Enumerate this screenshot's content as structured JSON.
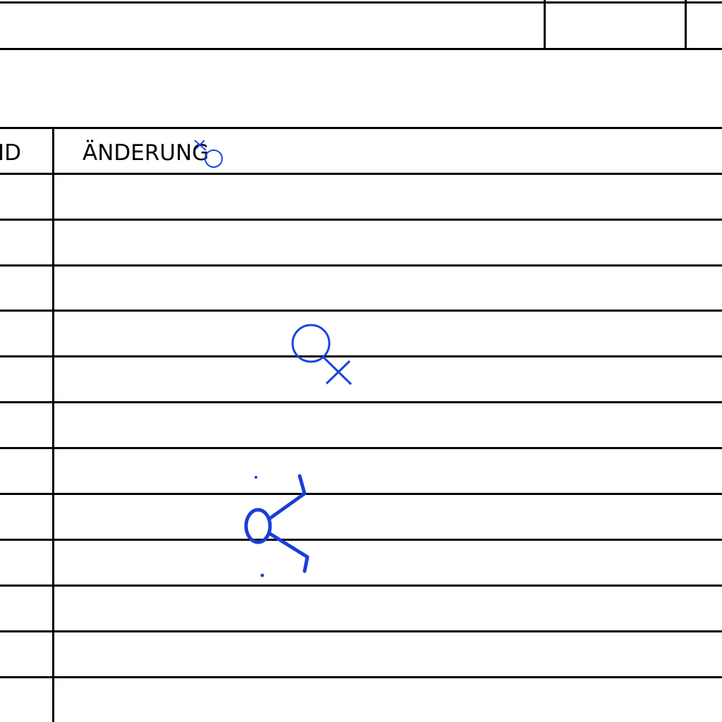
{
  "table": {
    "headers": {
      "id": "ID",
      "change": "ÄNDERUNG"
    },
    "row_count": 12
  },
  "annotation_color": "#1a44e0"
}
